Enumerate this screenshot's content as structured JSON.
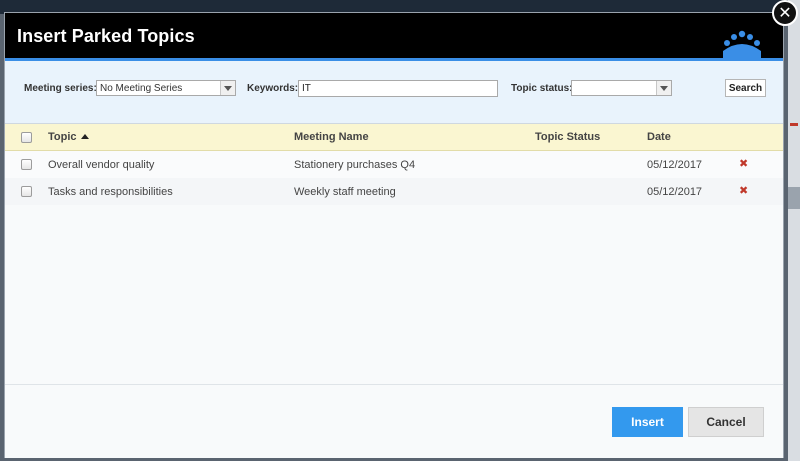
{
  "dialog": {
    "title": "Insert Parked Topics",
    "close_symbol": "✕"
  },
  "filters": {
    "meeting_series_label": "Meeting series:",
    "meeting_series_value": "No Meeting Series",
    "keywords_label": "Keywords:",
    "keywords_value": "IT",
    "topic_status_label": "Topic status:",
    "topic_status_value": "",
    "search_label": "Search"
  },
  "table": {
    "columns": [
      "Topic",
      "Meeting Name",
      "Topic Status",
      "Date"
    ],
    "sort_column": "Topic",
    "sort_direction": "ascending",
    "rows": [
      {
        "topic": "Overall vendor quality",
        "meeting_name": "Stationery purchases Q4",
        "topic_status": "",
        "date": "05/12/2017",
        "delete_symbol": "✖"
      },
      {
        "topic": "Tasks and responsibilities",
        "meeting_name": "Weekly staff meeting",
        "topic_status": "",
        "date": "05/12/2017",
        "delete_symbol": "✖"
      }
    ]
  },
  "footer": {
    "insert_label": "Insert",
    "cancel_label": "Cancel"
  },
  "colors": {
    "titlebar": "#000000",
    "accent": "#3399ee",
    "header_row": "#faf6d1",
    "delete": "#c0392b"
  },
  "icons": [
    "close-icon",
    "logo-people-icon",
    "dropdown-arrow-icon",
    "sort-ascending-icon",
    "delete-icon",
    "checkbox-icon"
  ]
}
